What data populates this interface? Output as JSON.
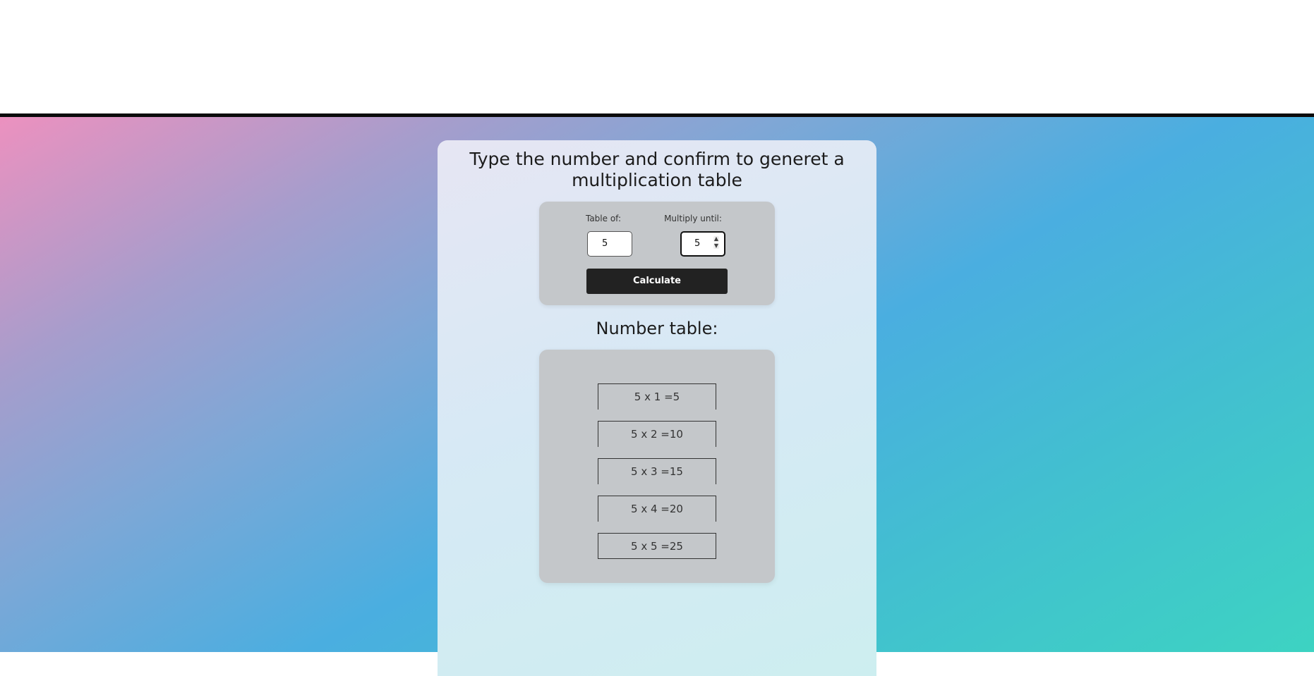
{
  "header": {
    "title_line1": "Type the number and confirm to generet a",
    "title_line2": "multiplication table"
  },
  "form": {
    "table_of_label": "Table of:",
    "table_of_value": "5",
    "multiply_until_label": "Multiply until:",
    "multiply_until_value": "5",
    "calculate_label": "Calculate"
  },
  "results": {
    "title": "Number table:",
    "rows": [
      "5 x 1 =5",
      "5 x 2 =10",
      "5 x 3 =15",
      "5 x 4 =20",
      "5 x 5 =25"
    ]
  },
  "colors": {
    "button": "#222222",
    "box": "#c4c7ca",
    "gradient_start": "#ec91bf",
    "gradient_end": "#3dd3c2"
  },
  "icons": [
    "spin-up-icon",
    "spin-down-icon"
  ]
}
